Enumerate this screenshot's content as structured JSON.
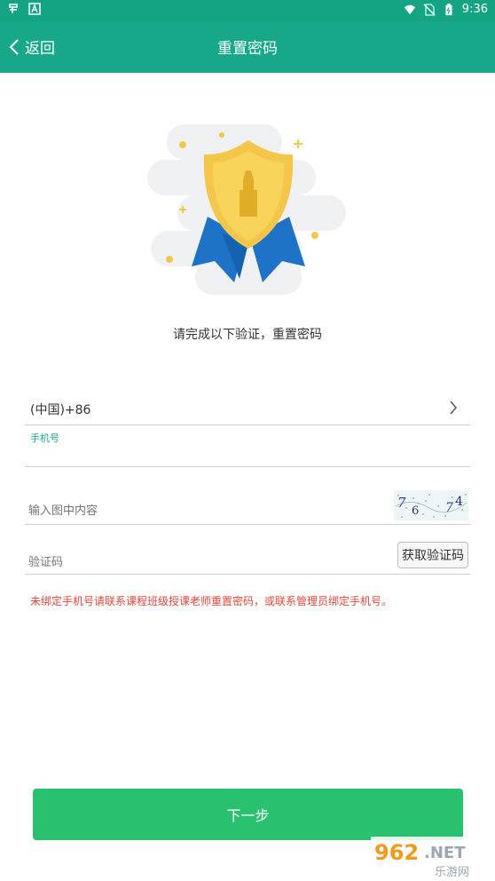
{
  "status_bar": {
    "time": "9:36",
    "icons": [
      "app-icon",
      "a-icon",
      "wifi-icon",
      "no-sim-icon",
      "battery-icon"
    ]
  },
  "app_bar": {
    "back_label": "返回",
    "title": "重置密码"
  },
  "illustration": {
    "name": "shield-badge-icon"
  },
  "subtitle": "请完成以下验证，重置密码",
  "form": {
    "country_code": "(中国)+86",
    "phone_label": "手机号",
    "phone_value": "",
    "captcha_placeholder": "输入图中内容",
    "captcha_text": "7 6 7 4",
    "code_placeholder": "验证码",
    "get_code_label": "获取验证码"
  },
  "notice": "未绑定手机号请联系课程班级授课老师重置密码，或联系管理员绑定手机号。",
  "next_button": "下一步",
  "watermark": {
    "brand": "962.NET",
    "sub": "乐游网"
  },
  "colors": {
    "app_bar": "#17a889",
    "accent": "#1aa98a",
    "button": "#29c070",
    "warning": "#e2463b"
  }
}
